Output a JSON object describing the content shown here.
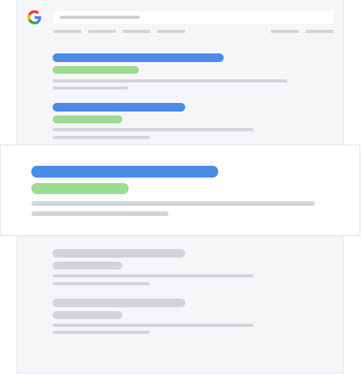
{
  "app": {
    "logo_icon": "google-g-logo-icon"
  },
  "colors": {
    "page_background": "#f6f6f8",
    "title_blue": "#4a8ce8",
    "url_green": "#9bdd8e",
    "placeholder_gray": "#d3d4da"
  },
  "search": {
    "placeholder": ""
  },
  "results": [
    {
      "state": "loaded"
    },
    {
      "state": "loaded"
    },
    {
      "state": "highlighted"
    },
    {
      "state": "loading"
    },
    {
      "state": "loading"
    }
  ]
}
